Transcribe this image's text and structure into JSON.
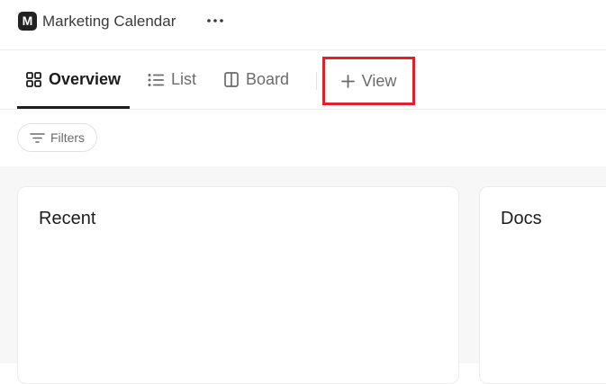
{
  "workspace": {
    "avatar_letter": "M",
    "title": "Marketing Calendar",
    "more_icon": "ellipsis-icon"
  },
  "tabs": [
    {
      "label": "Overview",
      "icon": "overview-grid-icon",
      "active": true
    },
    {
      "label": "List",
      "icon": "list-icon",
      "active": false
    },
    {
      "label": "Board",
      "icon": "board-icon",
      "active": false
    }
  ],
  "add_view": {
    "label": "View",
    "icon": "plus-icon",
    "highlight_color": "#e0202a"
  },
  "filters": {
    "label": "Filters",
    "icon": "filter-icon"
  },
  "cards": [
    {
      "title": "Recent"
    },
    {
      "title": "Docs"
    }
  ]
}
